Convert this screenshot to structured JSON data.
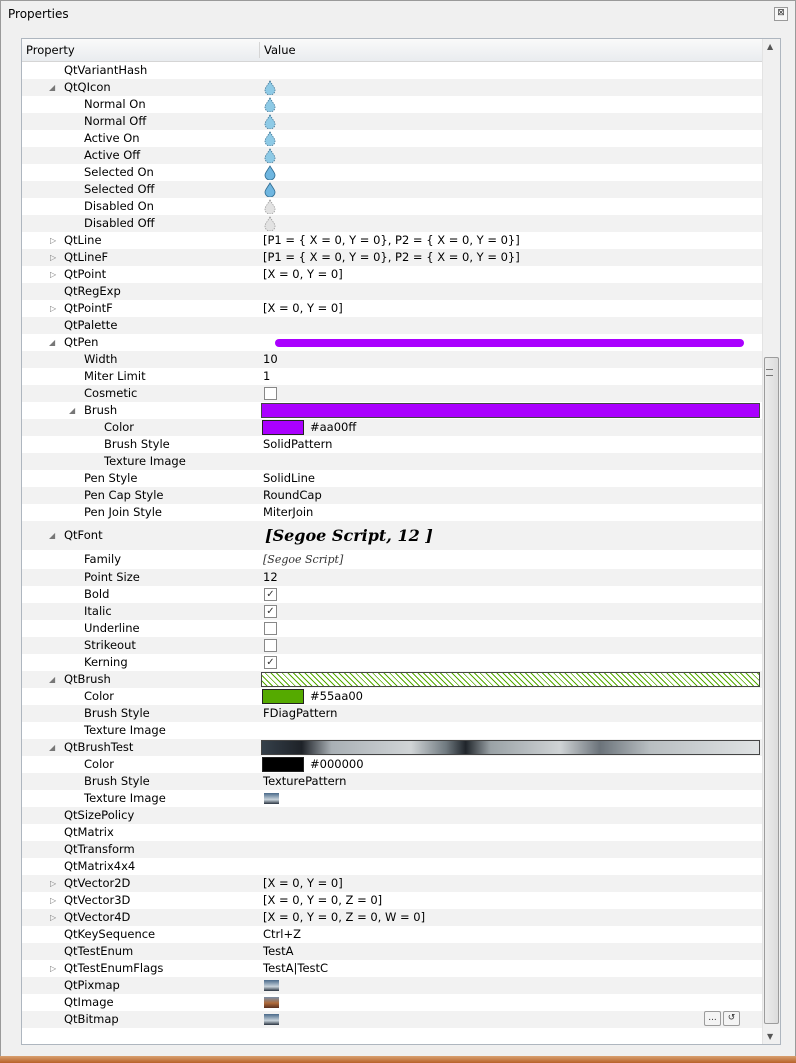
{
  "window": {
    "title": "Properties",
    "close_label": "⊠"
  },
  "header": {
    "property": "Property",
    "value": "Value"
  },
  "colors": {
    "pen": "#aa00ff",
    "brush_color": "#55aa00",
    "brush_test_color": "#000000"
  },
  "rows": {
    "variantHash": "QtVariantHash",
    "qicon": "QtQIcon",
    "normalOn": "Normal On",
    "normalOff": "Normal Off",
    "activeOn": "Active On",
    "activeOff": "Active Off",
    "selectedOn": "Selected On",
    "selectedOff": "Selected Off",
    "disabledOn": "Disabled On",
    "disabledOff": "Disabled Off",
    "line": {
      "name": "QtLine",
      "value": "[P1 = { X = 0, Y = 0}, P2 = { X = 0, Y = 0}]"
    },
    "lineF": {
      "name": "QtLineF",
      "value": "[P1 = { X = 0, Y = 0}, P2 = { X = 0, Y = 0}]"
    },
    "point": {
      "name": "QtPoint",
      "value": "[X = 0, Y = 0]"
    },
    "regExp": "QtRegExp",
    "pointF": {
      "name": "QtPointF",
      "value": "[X = 0, Y = 0]"
    },
    "palette": "QtPalette",
    "pen": "QtPen",
    "width": {
      "name": "Width",
      "value": "10"
    },
    "miter": {
      "name": "Miter Limit",
      "value": "1"
    },
    "cosmetic": "Cosmetic",
    "brush": "Brush",
    "color": {
      "name": "Color",
      "value": "#aa00ff"
    },
    "brushStyle": {
      "name": "Brush Style",
      "value": "SolidPattern"
    },
    "textureImage": "Texture Image",
    "penStyle": {
      "name": "Pen Style",
      "value": "SolidLine"
    },
    "penCap": {
      "name": "Pen Cap Style",
      "value": "RoundCap"
    },
    "penJoin": {
      "name": "Pen Join Style",
      "value": "MiterJoin"
    },
    "font": {
      "name": "QtFont",
      "value": "[Segoe Script, 12 ]"
    },
    "family": {
      "name": "Family",
      "value": "[Segoe Script]"
    },
    "pointSize": {
      "name": "Point Size",
      "value": "12"
    },
    "bold": "Bold",
    "italic": "Italic",
    "underline": "Underline",
    "strikeout": "Strikeout",
    "kerning": "Kerning",
    "qtBrush": "QtBrush",
    "qtBrushColor": {
      "name": "Color",
      "value": "#55aa00"
    },
    "qtBrushStyle": {
      "name": "Brush Style",
      "value": "FDiagPattern"
    },
    "qtBrushTexture": "Texture Image",
    "brushTest": "QtBrushTest",
    "brushTestColor": {
      "name": "Color",
      "value": "#000000"
    },
    "brushTestStyle": {
      "name": "Brush Style",
      "value": "TexturePattern"
    },
    "brushTestTexture": "Texture Image",
    "sizePolicy": "QtSizePolicy",
    "matrix": "QtMatrix",
    "transform": "QtTransform",
    "matrix4x4": "QtMatrix4x4",
    "vector2d": {
      "name": "QtVector2D",
      "value": "[X = 0, Y = 0]"
    },
    "vector3d": {
      "name": "QtVector3D",
      "value": "[X = 0, Y = 0, Z = 0]"
    },
    "vector4d": {
      "name": "QtVector4D",
      "value": "[X = 0, Y = 0, Z = 0, W = 0]"
    },
    "keySeq": {
      "name": "QtKeySequence",
      "value": "Ctrl+Z"
    },
    "testEnum": {
      "name": "QtTestEnum",
      "value": "TestA"
    },
    "testEnumFlags": {
      "name": "QtTestEnumFlags",
      "value": "TestA|TestC"
    },
    "pixmap": "QtPixmap",
    "image": "QtImage",
    "bitmap": "QtBitmap"
  },
  "checkboxes": {
    "cosmetic": false,
    "bold": true,
    "italic": true,
    "underline": false,
    "strikeout": false,
    "kerning": true
  },
  "buttons": {
    "ellipsis": "...",
    "reset": "↺"
  }
}
